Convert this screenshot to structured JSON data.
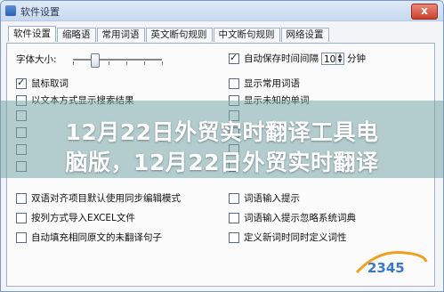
{
  "window": {
    "title": "软件设置",
    "close_symbol": "x"
  },
  "tabs": [
    "软件设置",
    "缩略语",
    "常用词语",
    "英文断句规则",
    "中文断句规则",
    "网络设置"
  ],
  "settings": {
    "font_size_label": "字体大小:",
    "autosave_label": "自动保存时间间隔",
    "autosave_value": "10",
    "autosave_unit": "分钟",
    "left_options": [
      {
        "label": "鼠标取词",
        "checked": true
      },
      {
        "label": "以文本方式显示搜索结果",
        "checked": false
      },
      {
        "label": "",
        "checked": false
      },
      {
        "label": "",
        "checked": false
      },
      {
        "label": "",
        "checked": false
      },
      {
        "label": "",
        "checked": false
      },
      {
        "label": "双语对齐项目默认使用同步编辑模式",
        "checked": false
      },
      {
        "label": "按列方式导入EXCEL文件",
        "checked": false
      },
      {
        "label": "自动填充相同原文的未翻译句子",
        "checked": false
      }
    ],
    "right_options": [
      {
        "label": "显示常用词语",
        "checked": false
      },
      {
        "label": "显示未知的单词",
        "checked": false
      },
      {
        "label": "",
        "checked": false
      },
      {
        "label": "",
        "checked": false
      },
      {
        "label": "",
        "checked": false
      },
      {
        "label": "",
        "checked": false
      },
      {
        "label": "词语输入提示",
        "checked": false
      },
      {
        "label": "词语输入提示忽略系统词典",
        "checked": false
      },
      {
        "label": "定义新词时同时定义词性",
        "checked": false
      }
    ]
  },
  "overlay": {
    "headline_line1": "12月22日外贸实时翻译工具电",
    "headline_line2": "脑版，12月22日外贸实时翻译"
  },
  "watermark": {
    "text": "2345",
    "color": "#3a78c9"
  }
}
